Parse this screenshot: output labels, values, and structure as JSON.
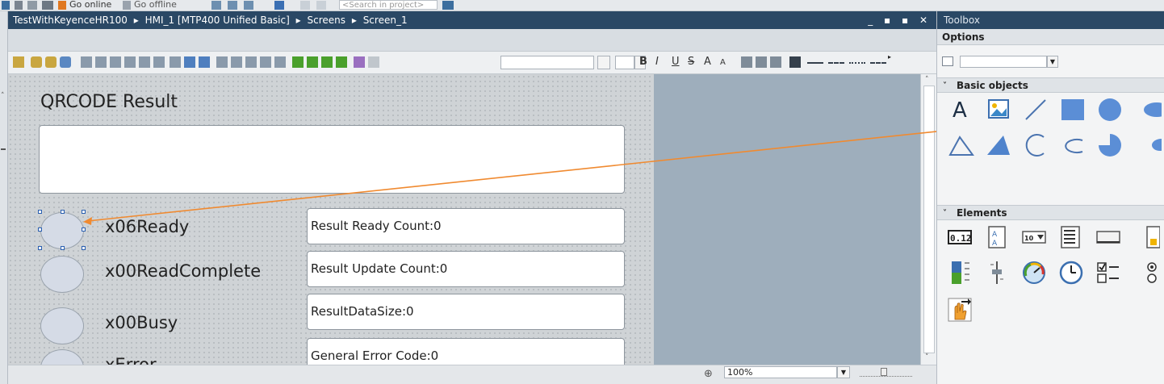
{
  "topbar": {
    "go_online": "Go online",
    "go_offline": "Go offline",
    "search_placeholder": "<Search in project>"
  },
  "editor": {
    "breadcrumb": [
      "TestWithKeyenceHR100",
      "HMI_1 [MTP400 Unified Basic]",
      "Screens",
      "Screen_1"
    ],
    "separator": "▸",
    "window_buttons": "_ ▪ ▪ ✕",
    "format_letters": {
      "bold": "B",
      "italic": "I",
      "underline": "U",
      "strike": "S",
      "grow": "A",
      "shrink": "A"
    }
  },
  "screen": {
    "title": "QRCODE Result",
    "indicators": [
      {
        "label": "x06Ready"
      },
      {
        "label": "x00ReadComplete"
      },
      {
        "label": "x00Busy"
      },
      {
        "label": "xError"
      }
    ],
    "fields": [
      "Result Ready Count:0",
      "Result Update Count:0",
      "ResultDataSize:0",
      "General Error Code:0"
    ]
  },
  "statusbar": {
    "zoom": "100%"
  },
  "toolbox": {
    "title": "Toolbox",
    "options_label": "Options",
    "sections": {
      "basic_objects": "Basic objects",
      "elements": "Elements"
    },
    "basic_objects": [
      "text-tool-icon",
      "graphic-view-tool-icon",
      "line-tool-icon",
      "rectangle-tool-icon",
      "circle-tool-icon",
      "ellipse-tool-icon",
      "polygon-tool-icon",
      "filled-triangle-tool-icon",
      "arc-tool-icon",
      "elliptical-arc-tool-icon",
      "pie-segment-tool-icon",
      "ellipse-segment-tool-icon"
    ],
    "elements": [
      "io-field-icon",
      "symbolic-io-field-icon",
      "combo-box-icon",
      "list-box-icon",
      "button-icon",
      "spin-box-icon",
      "bar-icon",
      "slider-icon",
      "gauge-icon",
      "clock-icon",
      "check-box-icon",
      "radio-button-icon",
      "touch-area-icon"
    ],
    "accent": "#2a4865"
  }
}
